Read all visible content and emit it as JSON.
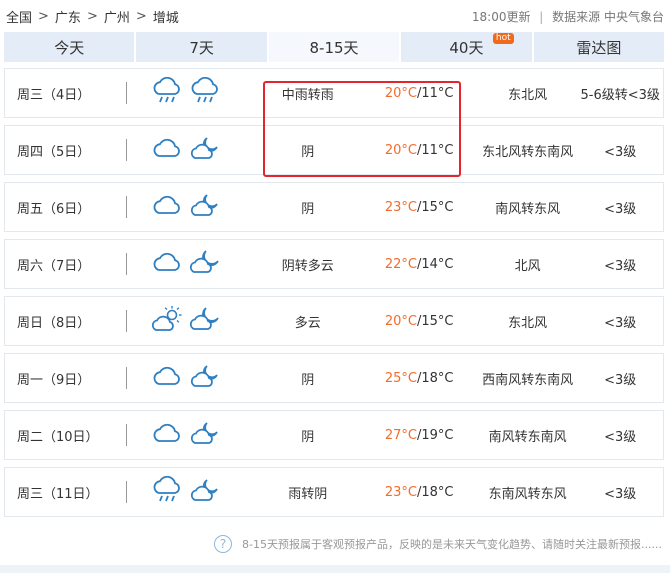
{
  "breadcrumb": {
    "items": [
      "全国",
      "广东",
      "广州",
      "增城"
    ],
    "separator": ">"
  },
  "meta": {
    "update_time": "18:00更新",
    "source": "数据来源 中央气象台",
    "divider": "|"
  },
  "tabs": [
    {
      "label": "今天",
      "active": false,
      "badge": ""
    },
    {
      "label": "7天",
      "active": false,
      "badge": ""
    },
    {
      "label": "8-15天",
      "active": true,
      "badge": ""
    },
    {
      "label": "40天",
      "active": false,
      "badge": "hot"
    },
    {
      "label": "雷达图",
      "active": false,
      "badge": ""
    }
  ],
  "forecast": [
    {
      "day": "周三（4日）",
      "icons": [
        "rain-cloud-icon",
        "rain-cloud-icon"
      ],
      "desc": "中雨转雨",
      "high": "20°C",
      "low": "11°C",
      "wind": "东北风",
      "power": "5-6级转<3级"
    },
    {
      "day": "周四（5日）",
      "icons": [
        "cloud-icon",
        "cloud-moon-icon"
      ],
      "desc": "阴",
      "high": "20°C",
      "low": "11°C",
      "wind": "东北风转东南风",
      "power": "<3级"
    },
    {
      "day": "周五（6日）",
      "icons": [
        "cloud-icon",
        "cloud-moon-icon"
      ],
      "desc": "阴",
      "high": "23°C",
      "low": "15°C",
      "wind": "南风转东风",
      "power": "<3级"
    },
    {
      "day": "周六（7日）",
      "icons": [
        "cloud-icon",
        "moon-cloud-icon"
      ],
      "desc": "阴转多云",
      "high": "22°C",
      "low": "14°C",
      "wind": "北风",
      "power": "<3级"
    },
    {
      "day": "周日（8日）",
      "icons": [
        "sun-cloud-icon",
        "moon-cloud-icon"
      ],
      "desc": "多云",
      "high": "20°C",
      "low": "15°C",
      "wind": "东北风",
      "power": "<3级"
    },
    {
      "day": "周一（9日）",
      "icons": [
        "cloud-icon",
        "cloud-moon-icon"
      ],
      "desc": "阴",
      "high": "25°C",
      "low": "18°C",
      "wind": "西南风转东南风",
      "power": "<3级"
    },
    {
      "day": "周二（10日）",
      "icons": [
        "cloud-icon",
        "cloud-moon-icon"
      ],
      "desc": "阴",
      "high": "27°C",
      "low": "19°C",
      "wind": "南风转东南风",
      "power": "<3级"
    },
    {
      "day": "周三（11日）",
      "icons": [
        "rain-cloud-icon",
        "cloud-moon-icon"
      ],
      "desc": "雨转阴",
      "high": "23°C",
      "low": "18°C",
      "wind": "东南风转东风",
      "power": "<3级"
    }
  ],
  "footer": {
    "help_glyph": "?",
    "note": "8-15天预报属于客观预报产品，反映的是未来天气变化趋势、请随时关注最新预报......"
  },
  "colors": {
    "tab_bg": "#e4edf7",
    "high_temp": "#f36b2b",
    "icon_stroke": "#2f7fc1",
    "highlight_border": "#e3262d"
  }
}
